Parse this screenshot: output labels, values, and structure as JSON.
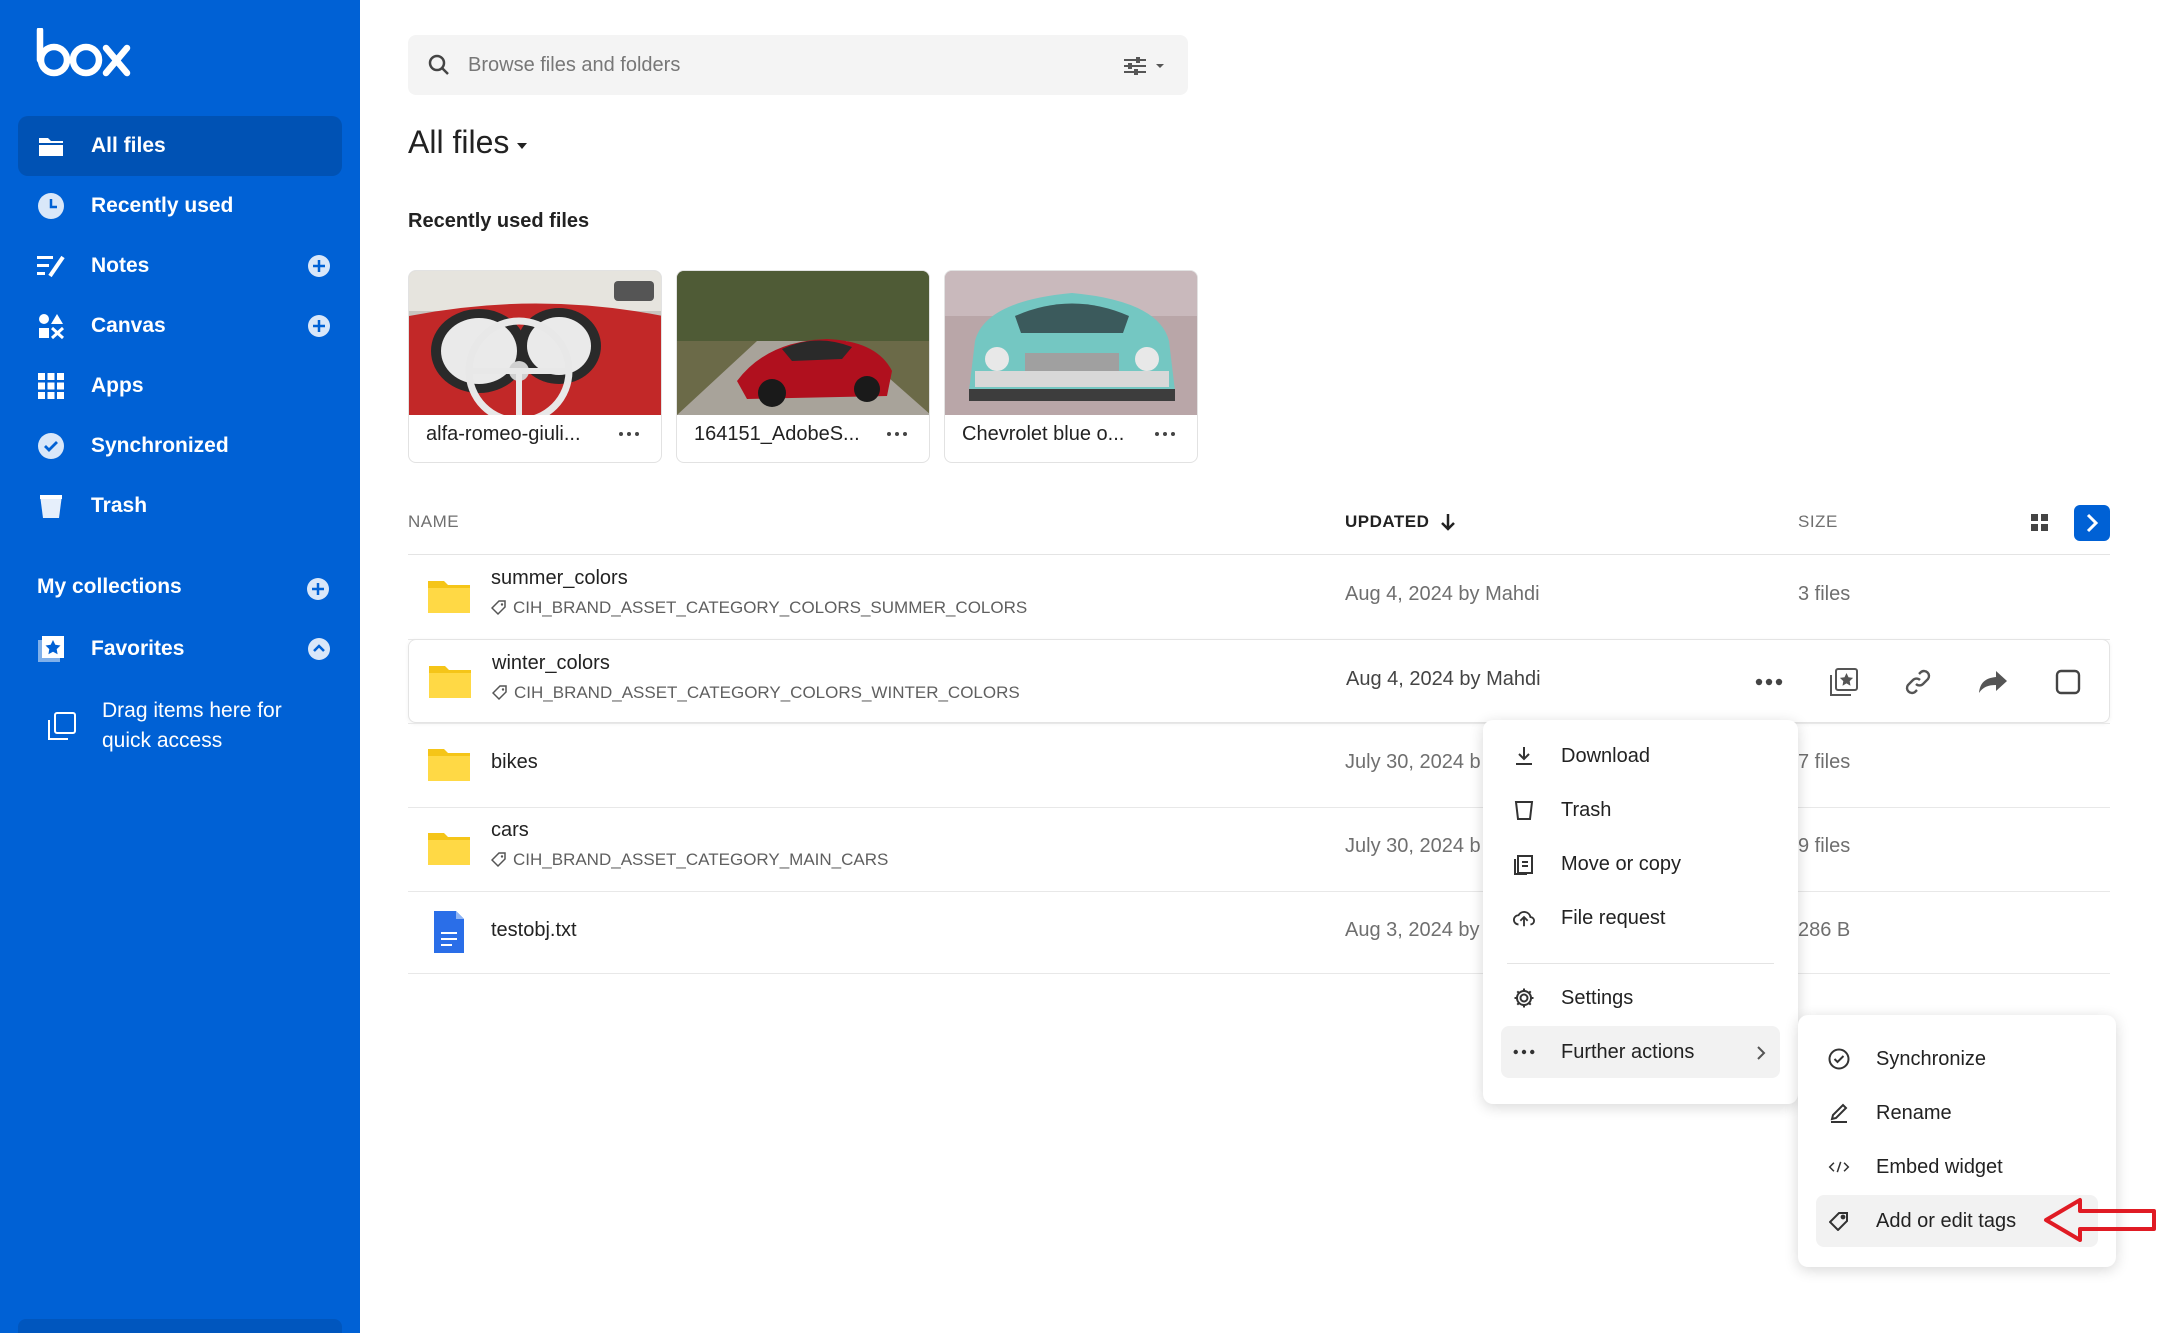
{
  "brand": {
    "logo_text": "box",
    "accent": "#0061d5"
  },
  "sidebar": {
    "items": [
      {
        "label": "All files",
        "icon": "folder-icon",
        "active": true
      },
      {
        "label": "Recently used",
        "icon": "clock-icon"
      },
      {
        "label": "Notes",
        "icon": "notes-icon",
        "add": true
      },
      {
        "label": "Canvas",
        "icon": "canvas-icon",
        "add": true
      },
      {
        "label": "Apps",
        "icon": "apps-grid-icon"
      },
      {
        "label": "Synchronized",
        "icon": "check-circle-icon"
      },
      {
        "label": "Trash",
        "icon": "trash-icon"
      }
    ],
    "my_collections": "My collections",
    "favorites": "Favorites",
    "drag_hint": "Drag items here for quick access"
  },
  "search": {
    "placeholder": "Browse files and folders"
  },
  "page_title": "All files",
  "recent": {
    "title": "Recently used files",
    "cards": [
      {
        "name": "alfa-romeo-giuli..."
      },
      {
        "name": "164151_AdobeS..."
      },
      {
        "name": "Chevrolet blue o..."
      }
    ]
  },
  "table": {
    "headers": {
      "name": "NAME",
      "updated": "UPDATED",
      "size": "SIZE"
    },
    "rows": [
      {
        "name": "summer_colors",
        "tag": "CIH_BRAND_ASSET_CATEGORY_COLORS_SUMMER_COLORS",
        "updated": "Aug 4, 2024 by Mahdi",
        "size": "3 files"
      },
      {
        "name": "winter_colors",
        "tag": "CIH_BRAND_ASSET_CATEGORY_COLORS_WINTER_COLORS",
        "updated": "Aug 4, 2024 by Mahdi",
        "size": ""
      },
      {
        "name": "bikes",
        "tag": "",
        "updated": "July 30, 2024 b",
        "size": "7 files"
      },
      {
        "name": "cars",
        "tag": "CIH_BRAND_ASSET_CATEGORY_MAIN_CARS",
        "updated": "July 30, 2024 b",
        "size": "9 files"
      },
      {
        "name": "testobj.txt",
        "tag": "",
        "updated": "Aug 3, 2024 by",
        "size": "286 B"
      }
    ]
  },
  "context_menu": {
    "items": [
      "Download",
      "Trash",
      "Move or copy",
      "File request",
      "Settings",
      "Further actions"
    ]
  },
  "submenu": {
    "items": [
      "Synchronize",
      "Rename",
      "Embed widget",
      "Add or edit tags"
    ]
  }
}
